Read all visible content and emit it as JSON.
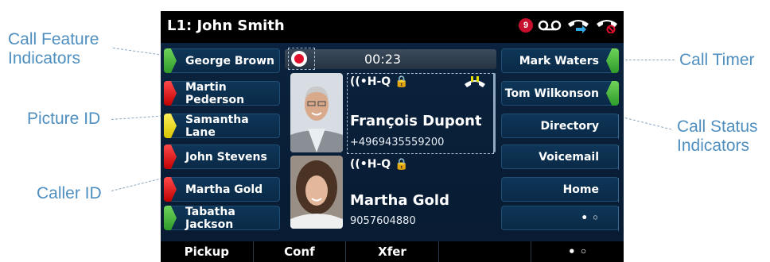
{
  "callouts": {
    "call_feature": "Call Feature Indicators",
    "call_feature_line1": "Call Feature",
    "call_feature_line2": "Indicators",
    "picture_id": "Picture ID",
    "caller_id": "Caller ID",
    "call_timer": "Call Timer",
    "call_status_line1": "Call Status",
    "call_status_line2": "Indicators"
  },
  "topbar": {
    "line_title": "L1: John Smith",
    "voicemail_count": "9",
    "icons": [
      "voicemail-icon",
      "handset-forward-icon",
      "handset-dnd-icon"
    ]
  },
  "left_keys": [
    {
      "label": "George Brown",
      "led": "green"
    },
    {
      "label": "Martin Pederson",
      "led": "red"
    },
    {
      "label": "Samantha Lane",
      "led": "yellow"
    },
    {
      "label": "John Stevens",
      "led": "red"
    },
    {
      "label": "Martha Gold",
      "led": "red"
    },
    {
      "label": "Tabatha Jackson",
      "led": "green"
    }
  ],
  "right_keys": [
    {
      "label": "Mark Waters",
      "led": "green"
    },
    {
      "label": "Tom Wilkonson",
      "led": "green"
    },
    {
      "label": "Directory",
      "led": "none"
    },
    {
      "label": "Voicemail",
      "led": "none"
    },
    {
      "label": "Home",
      "led": "none"
    },
    {
      "label": "• ◦",
      "led": "none"
    }
  ],
  "call_area": {
    "timer": "00:23",
    "calls": [
      {
        "hdq": "((•H-Q 🔒",
        "name": "François Dupont",
        "number": "+4969435559200",
        "on_hold": true
      },
      {
        "hdq": "((•H-Q 🔒",
        "name": "Martha Gold",
        "number": "9057604880",
        "on_hold": false
      }
    ]
  },
  "softkeys": [
    "Pickup",
    "Conf",
    "Xfer",
    "",
    "• ◦"
  ],
  "colors": {
    "screen_bg": "#0c2440",
    "callout_text": "#4f8fc0",
    "led_green": "#4cb845",
    "led_red": "#e01010",
    "led_yellow": "#f0e020",
    "record_red": "#e0102a"
  }
}
